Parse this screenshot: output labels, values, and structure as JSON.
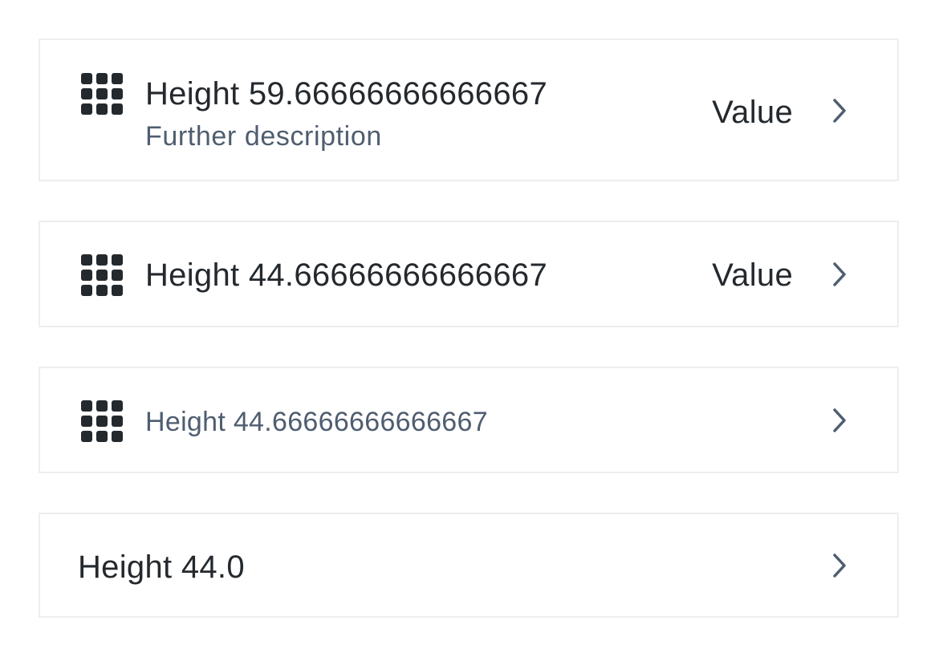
{
  "list": {
    "items": [
      {
        "title": "Height 59.66666666666667",
        "subtitle": "Further description",
        "value": "Value",
        "icon": "grid-icon",
        "chevron": "chevron-right-icon"
      },
      {
        "title": "Height 44.66666666666667",
        "value": "Value",
        "icon": "grid-icon",
        "chevron": "chevron-right-icon"
      },
      {
        "title": "Height 44.66666666666667",
        "icon": "grid-icon",
        "chevron": "chevron-right-icon"
      },
      {
        "title": "Height 44.0",
        "chevron": "chevron-right-icon"
      }
    ]
  },
  "colors": {
    "text_primary": "#24292e",
    "text_secondary": "#4f5d70",
    "border": "#eeeeee",
    "background": "#ffffff"
  }
}
